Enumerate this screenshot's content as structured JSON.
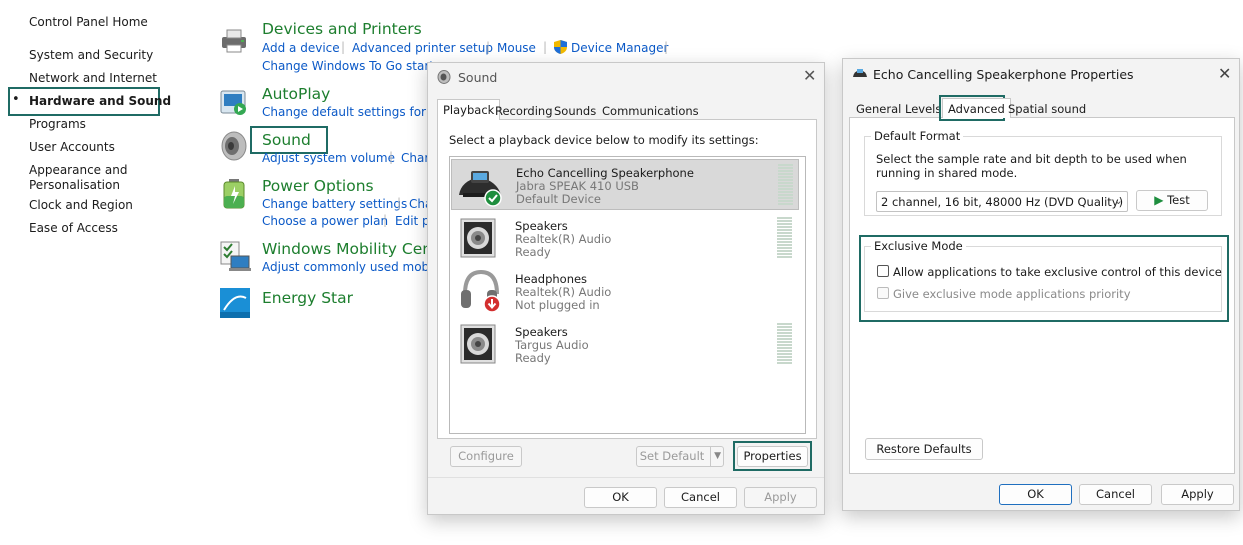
{
  "control_panel": {
    "nav": {
      "home": "Control Panel Home",
      "items": [
        "System and Security",
        "Network and Internet",
        "Hardware and Sound",
        "Programs",
        "User Accounts",
        "Appearance and Personalisation",
        "Clock and Region",
        "Ease of Access"
      ],
      "active_index": 2
    },
    "categories": {
      "devices": {
        "title": "Devices and Printers",
        "links": [
          "Add a device",
          "Advanced printer setup",
          "Mouse",
          "Device Manager"
        ],
        "link2": "Change Windows To Go start-u"
      },
      "autoplay": {
        "title": "AutoPlay",
        "link": "Change default settings for me"
      },
      "sound": {
        "title": "Sound",
        "links": [
          "Adjust system volume",
          "Char"
        ]
      },
      "power": {
        "title": "Power Options",
        "links": [
          "Change battery settings",
          "Cha"
        ],
        "links2": [
          "Choose a power plan",
          "Edit p"
        ]
      },
      "mobility": {
        "title": "Windows Mobility Centr",
        "link": "Adjust commonly used mobilit"
      },
      "energy": {
        "title": "Energy Star"
      }
    }
  },
  "sound_dialog": {
    "title": "Sound",
    "tabs": [
      "Playback",
      "Recording",
      "Sounds",
      "Communications"
    ],
    "active_tab": "Playback",
    "instruction": "Select a playback device below to modify its settings:",
    "devices": [
      {
        "name": "Echo Cancelling Speakerphone",
        "line2": "Jabra SPEAK 410 USB",
        "line3": "Default Device",
        "icon": "speakerphone-icon",
        "selected": true
      },
      {
        "name": "Speakers",
        "line2": "Realtek(R) Audio",
        "line3": "Ready",
        "icon": "speaker-icon"
      },
      {
        "name": "Headphones",
        "line2": "Realtek(R) Audio",
        "line3": "Not plugged in",
        "icon": "headphones-icon"
      },
      {
        "name": "Speakers",
        "line2": "Targus Audio",
        "line3": "Ready",
        "icon": "speaker-icon"
      }
    ],
    "buttons": {
      "configure": "Configure",
      "set_default": "Set Default",
      "properties": "Properties",
      "ok": "OK",
      "cancel": "Cancel",
      "apply": "Apply"
    }
  },
  "props_dialog": {
    "title": "Echo Cancelling Speakerphone Properties",
    "tabs": [
      "General",
      "Levels",
      "Advanced",
      "Spatial sound"
    ],
    "active_tab": "Advanced",
    "default_format": {
      "label": "Default Format",
      "description": "Select the sample rate and bit depth to be used when running in shared mode.",
      "selected": "2 channel, 16 bit, 48000 Hz (DVD Quality)",
      "test_button": "Test"
    },
    "exclusive_mode": {
      "label": "Exclusive Mode",
      "option1": "Allow applications to take exclusive control of this device",
      "option2": "Give exclusive mode applications priority",
      "option1_checked": false,
      "option2_checked": false
    },
    "buttons": {
      "restore": "Restore Defaults",
      "ok": "OK",
      "cancel": "Cancel",
      "apply": "Apply"
    }
  },
  "colors": {
    "highlight_border": "#1f6b64",
    "category_green": "#1d7e2e",
    "link_blue": "#0b59c7"
  }
}
